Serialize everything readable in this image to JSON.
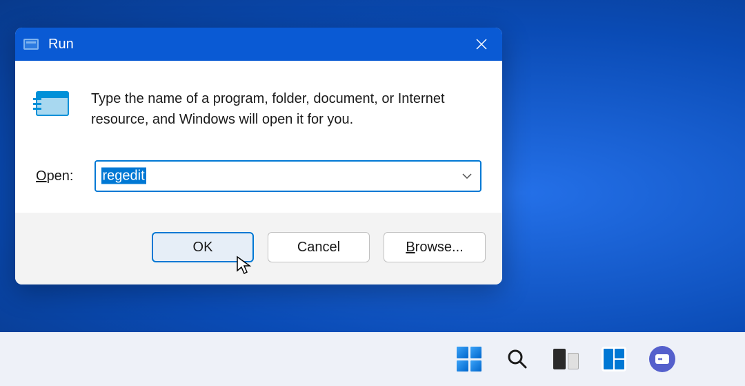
{
  "dialog": {
    "title": "Run",
    "description": "Type the name of a program, folder, document, or Internet resource, and Windows will open it for you.",
    "open_label_underlined": "O",
    "open_label_rest": "pen:",
    "input_value": "regedit",
    "buttons": {
      "ok": "OK",
      "cancel": "Cancel",
      "browse_underlined": "B",
      "browse_rest": "rowse..."
    }
  },
  "taskbar": {
    "icons": [
      "start",
      "search",
      "taskview",
      "widgets",
      "chat"
    ]
  }
}
